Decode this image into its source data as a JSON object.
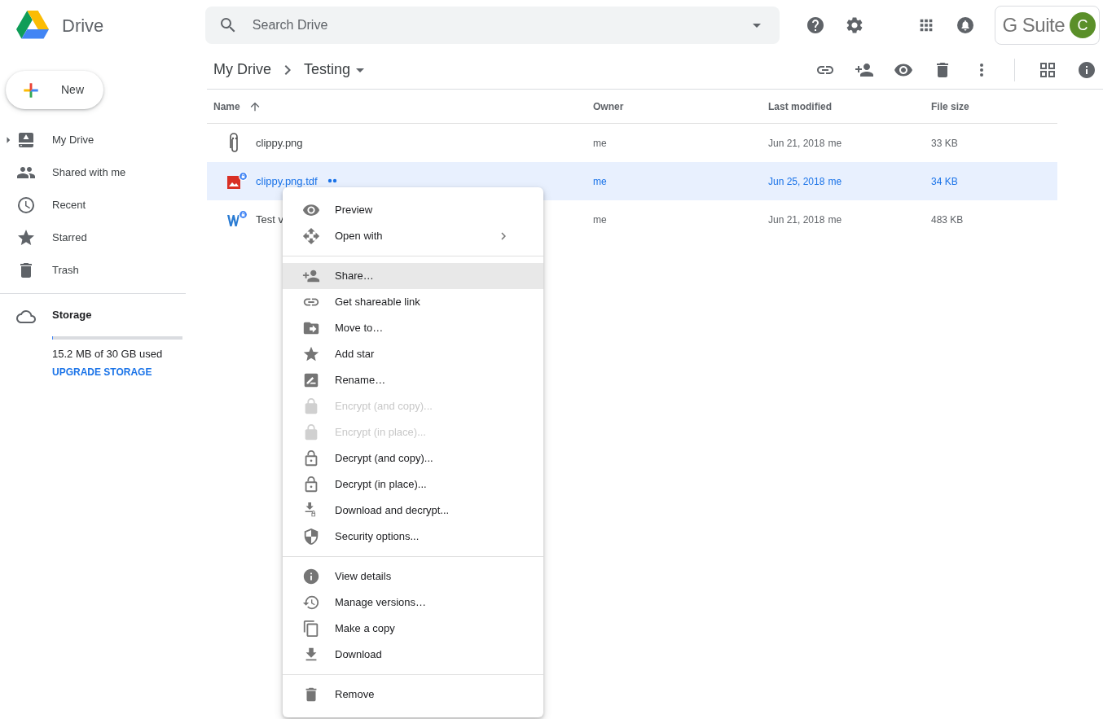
{
  "app": {
    "name": "Drive"
  },
  "search": {
    "placeholder": "Search Drive"
  },
  "account": {
    "brand": "G Suite",
    "avatar_initial": "C"
  },
  "new_button": {
    "label": "New"
  },
  "sidebar": {
    "items": [
      {
        "label": "My Drive",
        "expanded": false
      },
      {
        "label": "Shared with me"
      },
      {
        "label": "Recent"
      },
      {
        "label": "Starred"
      },
      {
        "label": "Trash"
      }
    ]
  },
  "storage": {
    "label": "Storage",
    "usage": "15.2 MB of 30 GB used",
    "level": 0.0005,
    "upgrade": "UPGRADE STORAGE"
  },
  "breadcrumb": [
    "My Drive",
    "Testing"
  ],
  "table": {
    "columns": [
      {
        "label": "Name",
        "sorted": true
      },
      {
        "label": "Owner",
        "sorted": false
      },
      {
        "label": "Last modified",
        "sorted": false
      },
      {
        "label": "File size",
        "sorted": false
      }
    ],
    "rows": [
      {
        "name": "clippy.png",
        "owner": "me",
        "modified": "Jun 21, 2018",
        "modified_by": "me",
        "size": "33 KB",
        "selected": false,
        "encrypted": false,
        "shared": false
      },
      {
        "name": "clippy.png.tdf",
        "owner": "me",
        "modified": "Jun 25, 2018",
        "modified_by": "me",
        "size": "34 KB",
        "selected": true,
        "encrypted": true,
        "shared": true
      },
      {
        "name": "Test v",
        "owner": "me",
        "modified": "Jun 21, 2018",
        "modified_by": "me",
        "size": "483 KB",
        "selected": false,
        "encrypted": true,
        "shared": false
      }
    ]
  },
  "menu": {
    "sections": [
      {
        "items": [
          {
            "label": "Preview",
            "disabled": false,
            "selected": false,
            "submenu": false
          },
          {
            "label": "Open with",
            "disabled": false,
            "selected": false,
            "submenu": true
          }
        ]
      },
      {
        "items": [
          {
            "label": "Share…",
            "disabled": false,
            "selected": true,
            "submenu": false
          },
          {
            "label": "Get shareable link",
            "disabled": false,
            "selected": false,
            "submenu": false
          },
          {
            "label": "Move to…",
            "disabled": false,
            "selected": false,
            "submenu": false
          },
          {
            "label": "Add star",
            "disabled": false,
            "selected": false,
            "submenu": false
          },
          {
            "label": "Rename…",
            "disabled": false,
            "selected": false,
            "submenu": false
          },
          {
            "label": "Encrypt (and copy)...",
            "disabled": true,
            "selected": false,
            "submenu": false
          },
          {
            "label": "Encrypt (in place)...",
            "disabled": true,
            "selected": false,
            "submenu": false
          },
          {
            "label": "Decrypt (and copy)...",
            "disabled": false,
            "selected": false,
            "submenu": false
          },
          {
            "label": "Decrypt (in place)...",
            "disabled": false,
            "selected": false,
            "submenu": false
          },
          {
            "label": "Download and decrypt...",
            "disabled": false,
            "selected": false,
            "submenu": false
          },
          {
            "label": "Security options...",
            "disabled": false,
            "selected": false,
            "submenu": false
          }
        ]
      },
      {
        "items": [
          {
            "label": "View details",
            "disabled": false,
            "selected": false,
            "submenu": false
          },
          {
            "label": "Manage versions…",
            "disabled": false,
            "selected": false,
            "submenu": false
          },
          {
            "label": "Make a copy",
            "disabled": false,
            "selected": false,
            "submenu": false
          },
          {
            "label": "Download",
            "disabled": false,
            "selected": false,
            "submenu": false
          }
        ]
      },
      {
        "items": [
          {
            "label": "Remove",
            "disabled": false,
            "selected": false,
            "submenu": false
          }
        ]
      }
    ]
  }
}
